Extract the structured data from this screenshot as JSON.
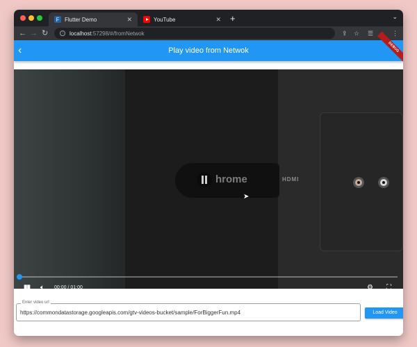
{
  "browser": {
    "tabs": [
      {
        "title": "Flutter Demo",
        "active": true
      },
      {
        "title": "YouTube",
        "active": false
      }
    ],
    "url_host": "localhost",
    "url_rest": ":57298/#/fromNetwok"
  },
  "app": {
    "title": "Play video from Netwok",
    "debug_label": "DEBUG"
  },
  "video": {
    "screen_text": "hrome",
    "hdmi_text": "HDMI",
    "time": "00:00 / 01:00",
    "progress_fraction": 0.0
  },
  "form": {
    "input_label": "Enter video url",
    "input_value": "https://commondatastorage.googleapis.com/gtv-videos-bucket/sample/ForBiggerFun.mp4",
    "load_button": "Load Video"
  },
  "colors": {
    "accent": "#2196f3",
    "chrome_dark": "#202124",
    "background": "#f0c9c6"
  }
}
